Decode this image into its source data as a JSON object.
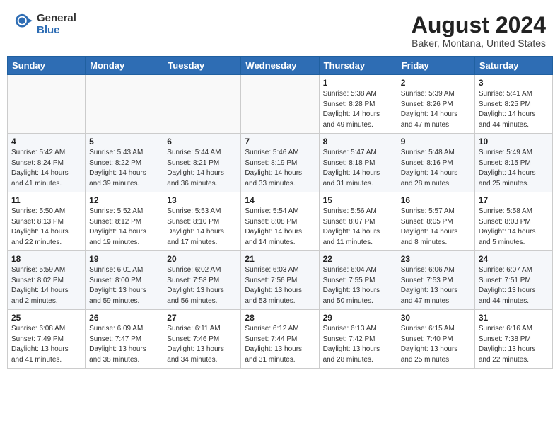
{
  "header": {
    "logo_general": "General",
    "logo_blue": "Blue",
    "main_title": "August 2024",
    "subtitle": "Baker, Montana, United States"
  },
  "days_of_week": [
    "Sunday",
    "Monday",
    "Tuesday",
    "Wednesday",
    "Thursday",
    "Friday",
    "Saturday"
  ],
  "weeks": [
    [
      {
        "day": "",
        "info": ""
      },
      {
        "day": "",
        "info": ""
      },
      {
        "day": "",
        "info": ""
      },
      {
        "day": "",
        "info": ""
      },
      {
        "day": "1",
        "info": "Sunrise: 5:38 AM\nSunset: 8:28 PM\nDaylight: 14 hours and 49 minutes."
      },
      {
        "day": "2",
        "info": "Sunrise: 5:39 AM\nSunset: 8:26 PM\nDaylight: 14 hours and 47 minutes."
      },
      {
        "day": "3",
        "info": "Sunrise: 5:41 AM\nSunset: 8:25 PM\nDaylight: 14 hours and 44 minutes."
      }
    ],
    [
      {
        "day": "4",
        "info": "Sunrise: 5:42 AM\nSunset: 8:24 PM\nDaylight: 14 hours and 41 minutes."
      },
      {
        "day": "5",
        "info": "Sunrise: 5:43 AM\nSunset: 8:22 PM\nDaylight: 14 hours and 39 minutes."
      },
      {
        "day": "6",
        "info": "Sunrise: 5:44 AM\nSunset: 8:21 PM\nDaylight: 14 hours and 36 minutes."
      },
      {
        "day": "7",
        "info": "Sunrise: 5:46 AM\nSunset: 8:19 PM\nDaylight: 14 hours and 33 minutes."
      },
      {
        "day": "8",
        "info": "Sunrise: 5:47 AM\nSunset: 8:18 PM\nDaylight: 14 hours and 31 minutes."
      },
      {
        "day": "9",
        "info": "Sunrise: 5:48 AM\nSunset: 8:16 PM\nDaylight: 14 hours and 28 minutes."
      },
      {
        "day": "10",
        "info": "Sunrise: 5:49 AM\nSunset: 8:15 PM\nDaylight: 14 hours and 25 minutes."
      }
    ],
    [
      {
        "day": "11",
        "info": "Sunrise: 5:50 AM\nSunset: 8:13 PM\nDaylight: 14 hours and 22 minutes."
      },
      {
        "day": "12",
        "info": "Sunrise: 5:52 AM\nSunset: 8:12 PM\nDaylight: 14 hours and 19 minutes."
      },
      {
        "day": "13",
        "info": "Sunrise: 5:53 AM\nSunset: 8:10 PM\nDaylight: 14 hours and 17 minutes."
      },
      {
        "day": "14",
        "info": "Sunrise: 5:54 AM\nSunset: 8:08 PM\nDaylight: 14 hours and 14 minutes."
      },
      {
        "day": "15",
        "info": "Sunrise: 5:56 AM\nSunset: 8:07 PM\nDaylight: 14 hours and 11 minutes."
      },
      {
        "day": "16",
        "info": "Sunrise: 5:57 AM\nSunset: 8:05 PM\nDaylight: 14 hours and 8 minutes."
      },
      {
        "day": "17",
        "info": "Sunrise: 5:58 AM\nSunset: 8:03 PM\nDaylight: 14 hours and 5 minutes."
      }
    ],
    [
      {
        "day": "18",
        "info": "Sunrise: 5:59 AM\nSunset: 8:02 PM\nDaylight: 14 hours and 2 minutes."
      },
      {
        "day": "19",
        "info": "Sunrise: 6:01 AM\nSunset: 8:00 PM\nDaylight: 13 hours and 59 minutes."
      },
      {
        "day": "20",
        "info": "Sunrise: 6:02 AM\nSunset: 7:58 PM\nDaylight: 13 hours and 56 minutes."
      },
      {
        "day": "21",
        "info": "Sunrise: 6:03 AM\nSunset: 7:56 PM\nDaylight: 13 hours and 53 minutes."
      },
      {
        "day": "22",
        "info": "Sunrise: 6:04 AM\nSunset: 7:55 PM\nDaylight: 13 hours and 50 minutes."
      },
      {
        "day": "23",
        "info": "Sunrise: 6:06 AM\nSunset: 7:53 PM\nDaylight: 13 hours and 47 minutes."
      },
      {
        "day": "24",
        "info": "Sunrise: 6:07 AM\nSunset: 7:51 PM\nDaylight: 13 hours and 44 minutes."
      }
    ],
    [
      {
        "day": "25",
        "info": "Sunrise: 6:08 AM\nSunset: 7:49 PM\nDaylight: 13 hours and 41 minutes."
      },
      {
        "day": "26",
        "info": "Sunrise: 6:09 AM\nSunset: 7:47 PM\nDaylight: 13 hours and 38 minutes."
      },
      {
        "day": "27",
        "info": "Sunrise: 6:11 AM\nSunset: 7:46 PM\nDaylight: 13 hours and 34 minutes."
      },
      {
        "day": "28",
        "info": "Sunrise: 6:12 AM\nSunset: 7:44 PM\nDaylight: 13 hours and 31 minutes."
      },
      {
        "day": "29",
        "info": "Sunrise: 6:13 AM\nSunset: 7:42 PM\nDaylight: 13 hours and 28 minutes."
      },
      {
        "day": "30",
        "info": "Sunrise: 6:15 AM\nSunset: 7:40 PM\nDaylight: 13 hours and 25 minutes."
      },
      {
        "day": "31",
        "info": "Sunrise: 6:16 AM\nSunset: 7:38 PM\nDaylight: 13 hours and 22 minutes."
      }
    ]
  ]
}
